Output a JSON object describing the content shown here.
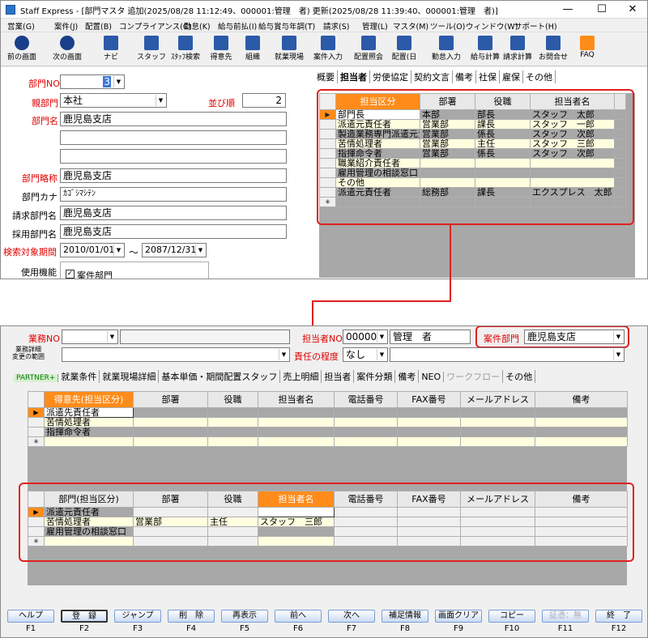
{
  "window": {
    "title": "Staff Express - [部門マスタ 追加(2025/08/28 11:12:49、000001:管理　者) 更新(2025/08/28 11:39:40、000001:管理　者)]"
  },
  "menu": [
    "営業(G)",
    "案件(J)",
    "配置(B)",
    "コンプライアンス(C)",
    "勤怠(K)",
    "給与前払(I)",
    "給与賞与年調(T)",
    "請求(S)",
    "管理(L)",
    "マスタ(M)",
    "ツール(O)",
    "ウィンドウ(W)",
    "サポート(H)"
  ],
  "toolbar": [
    "前の画面",
    "次の画面",
    "ナビ",
    "スタッフ",
    "ｽﾀｯﾌ検索",
    "得意先",
    "組織",
    "就業現場",
    "案件入力",
    "配置照会",
    "配置(日",
    "勤怠入力",
    "給与計算",
    "請求計算",
    "お問合せ",
    "FAQ"
  ],
  "form": {
    "dept_no_label": "部門NO",
    "dept_no": "3",
    "parent_label": "親部門",
    "parent": "本社",
    "order_label": "並び順",
    "order": "2",
    "dept_name_label": "部門名",
    "dept_name": "鹿児島支店",
    "short_label": "部門略称",
    "short": "鹿児島支店",
    "kana_label": "部門カナ",
    "kana": "ｶｺﾞｼﾏｼﾃﾝ",
    "bill_label": "請求部門名",
    "bill": "鹿児島支店",
    "hire_label": "採用部門名",
    "hire": "鹿児島支店",
    "period_label": "検索対象期間",
    "from": "2010/01/01",
    "to": "2087/12/31",
    "tilde": "～",
    "func_label": "使用機能",
    "func_check": "案件部門"
  },
  "top_tabs": [
    "概要",
    "担当者",
    "労使協定",
    "契約文言",
    "備考",
    "社保",
    "雇保",
    "その他"
  ],
  "top_grid": {
    "headers": [
      "担当区分",
      "部署",
      "役職",
      "担当者名"
    ],
    "rows": [
      [
        "部門長",
        "本部",
        "部長",
        "スタッフ　太郎"
      ],
      [
        "派遣元責任者",
        "営業部",
        "課長",
        "スタッフ　一郎"
      ],
      [
        "製造業務専門派遣元責",
        "営業部",
        "係長",
        "スタッフ　次郎"
      ],
      [
        "苦情処理者",
        "営業部",
        "主任",
        "スタッフ　三郎"
      ],
      [
        "指揮命令者",
        "営業部",
        "係長",
        "スタッフ　次郎"
      ],
      [
        "職業紹介責任者",
        "",
        "",
        ""
      ],
      [
        "雇用管理の相談窓口",
        "",
        "",
        ""
      ],
      [
        "その他",
        "",
        "",
        ""
      ],
      [
        "派遣元責任者",
        "総務部",
        "課長",
        "エクスプレス　太郎"
      ]
    ]
  },
  "second": {
    "biz_no_label": "業務NO",
    "detail_label": "業務詳細\n変更の範囲",
    "tanto_no_label": "担当者NO",
    "tanto_no": "000001",
    "tanto_name": "管理　者",
    "anken_label": "案件部門",
    "anken": "鹿児島支店",
    "resp_label": "責任の程度",
    "resp": "なし",
    "tabs": [
      "PARTNER+",
      "就業条件",
      "就業現場詳細",
      "基本単価・期間配置スタッフ",
      "売上明細",
      "担当者",
      "案件分類",
      "備考",
      "NEO",
      "ワークフロー",
      "その他"
    ],
    "grid1": {
      "headers": [
        "得意先(担当区分)",
        "部署",
        "役職",
        "担当者名",
        "電話番号",
        "FAX番号",
        "メールアドレス",
        "備考"
      ],
      "rows": [
        [
          "派遣先責任者"
        ],
        [
          "苦情処理者"
        ],
        [
          "指揮命令者"
        ]
      ]
    },
    "grid2": {
      "headers": [
        "部門(担当区分)",
        "部署",
        "役職",
        "担当者名",
        "電話番号",
        "FAX番号",
        "メールアドレス",
        "備考"
      ],
      "rows": [
        [
          "派遣元責任者",
          "",
          "",
          ""
        ],
        [
          "苦情処理者",
          "営業部",
          "主任",
          "スタッフ　三郎"
        ],
        [
          "雇用管理の相談窓口",
          "",
          "",
          ""
        ]
      ]
    }
  },
  "fkeys": [
    {
      "label": "ヘルプ",
      "key": "F1"
    },
    {
      "label": "登　録",
      "key": "F2"
    },
    {
      "label": "ジャンプ",
      "key": "F3"
    },
    {
      "label": "削　除",
      "key": "F4"
    },
    {
      "label": "再表示",
      "key": "F5"
    },
    {
      "label": "前へ",
      "key": "F6"
    },
    {
      "label": "次へ",
      "key": "F7"
    },
    {
      "label": "補足情報",
      "key": "F8"
    },
    {
      "label": "画面クリア",
      "key": "F9"
    },
    {
      "label": "コピー",
      "key": "F10"
    },
    {
      "label": "証憑：無",
      "key": "F11"
    },
    {
      "label": "終　了",
      "key": "F12"
    }
  ],
  "colors": {
    "accent": "#ff8c1a",
    "highlight": "#e02020",
    "row_yellow": "#ffffe0"
  }
}
